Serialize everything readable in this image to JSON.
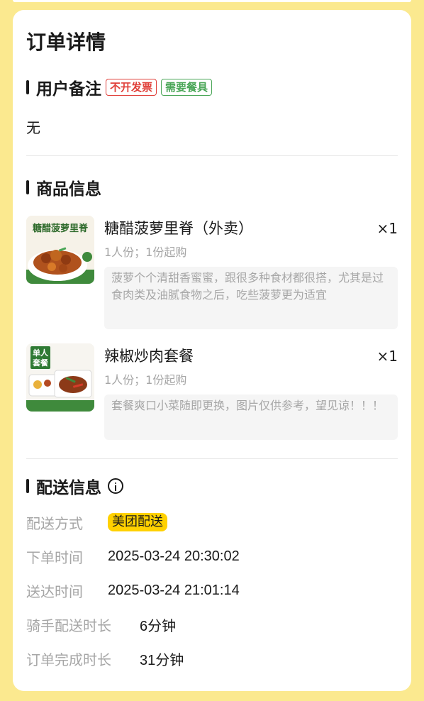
{
  "page_title": "订单详情",
  "remark": {
    "title": "用户备注",
    "tags": [
      {
        "label": "不开发票",
        "color": "#e0413b"
      },
      {
        "label": "需要餐具",
        "color": "#4aa657"
      }
    ],
    "text": "无"
  },
  "products": {
    "title": "商品信息",
    "items": [
      {
        "name": "糖醋菠萝里脊（外卖）",
        "qty": "×1",
        "spec": "1人份；1份起购",
        "desc": "菠萝个个清甜香蜜蜜，跟很多种食材都很搭，尤其是过食肉类及油腻食物之后，吃些菠萝更为适宜",
        "thumb_label": "糖醋菠萝里脊",
        "thumb_icon": "dish-photo-icon"
      },
      {
        "name": "辣椒炒肉套餐",
        "qty": "×1",
        "spec": "1人份；1份起购",
        "desc": "套餐爽口小菜随即更换，图片仅供参考，望见谅！！！",
        "thumb_label_line1": "单人",
        "thumb_label_line2": "套餐",
        "thumb_icon": "meal-box-photo-icon"
      }
    ]
  },
  "delivery": {
    "title": "配送信息",
    "method_label": "配送方式",
    "method_value": "美团配送",
    "order_time_label": "下单时间",
    "order_time_value": "2025-03-24 20:30:02",
    "arrive_time_label": "送达时间",
    "arrive_time_value": "2025-03-24 21:01:14",
    "rider_duration_label": "骑手配送时长",
    "rider_duration_value": "6分钟",
    "complete_duration_label": "订单完成时长",
    "complete_duration_value": "31分钟"
  },
  "colors": {
    "background": "#fbe98f",
    "card": "#ffffff",
    "accent_yellow": "#ffd100",
    "muted_text": "#a6a6a6"
  }
}
